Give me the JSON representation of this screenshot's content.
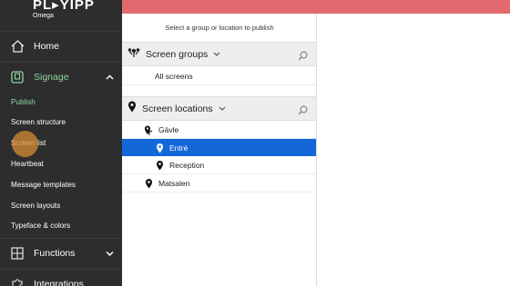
{
  "brand": {
    "logo": "PL▸YIPP",
    "subtitle": "Omega"
  },
  "nav": {
    "home": "Home",
    "signage": "Signage",
    "functions": "Functions",
    "integrations": "Integrations"
  },
  "signage_submenu": [
    "Publish",
    "Screen structure",
    "Screen list",
    "Heartbeat",
    "Message templates",
    "Screen layouts",
    "Typeface & colors"
  ],
  "panel": {
    "hint": "Select a group or location to publish",
    "groups_title": "Screen groups",
    "groups": [
      "All screens"
    ],
    "locations_title": "Screen locations",
    "locations": [
      "Gävle",
      "Entré",
      "Reception",
      "Matsalen"
    ]
  },
  "colors": {
    "accent_green": "#8fd6a0",
    "selected_blue": "#1467d9",
    "top_bar_red": "#e06a6e"
  }
}
